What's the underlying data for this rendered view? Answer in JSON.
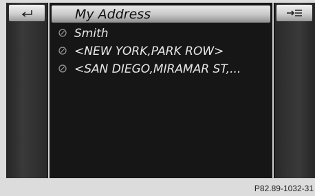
{
  "header": {
    "title": "My Address",
    "back_icon": "back-arrow-icon",
    "options_icon": "options-menu-icon"
  },
  "address_list": [
    {
      "label": "Smith",
      "icon": "address-entry-icon"
    },
    {
      "label": "<NEW YORK,PARK ROW>",
      "icon": "address-entry-icon"
    },
    {
      "label": "<SAN DIEGO,MIRAMAR ST,...",
      "icon": "address-entry-icon"
    }
  ],
  "footer": {
    "reference_code": "P82.89-1032-31"
  },
  "colors": {
    "screen_background": "#161616",
    "item_text": "#e8e8e8",
    "title_text": "#111111"
  }
}
